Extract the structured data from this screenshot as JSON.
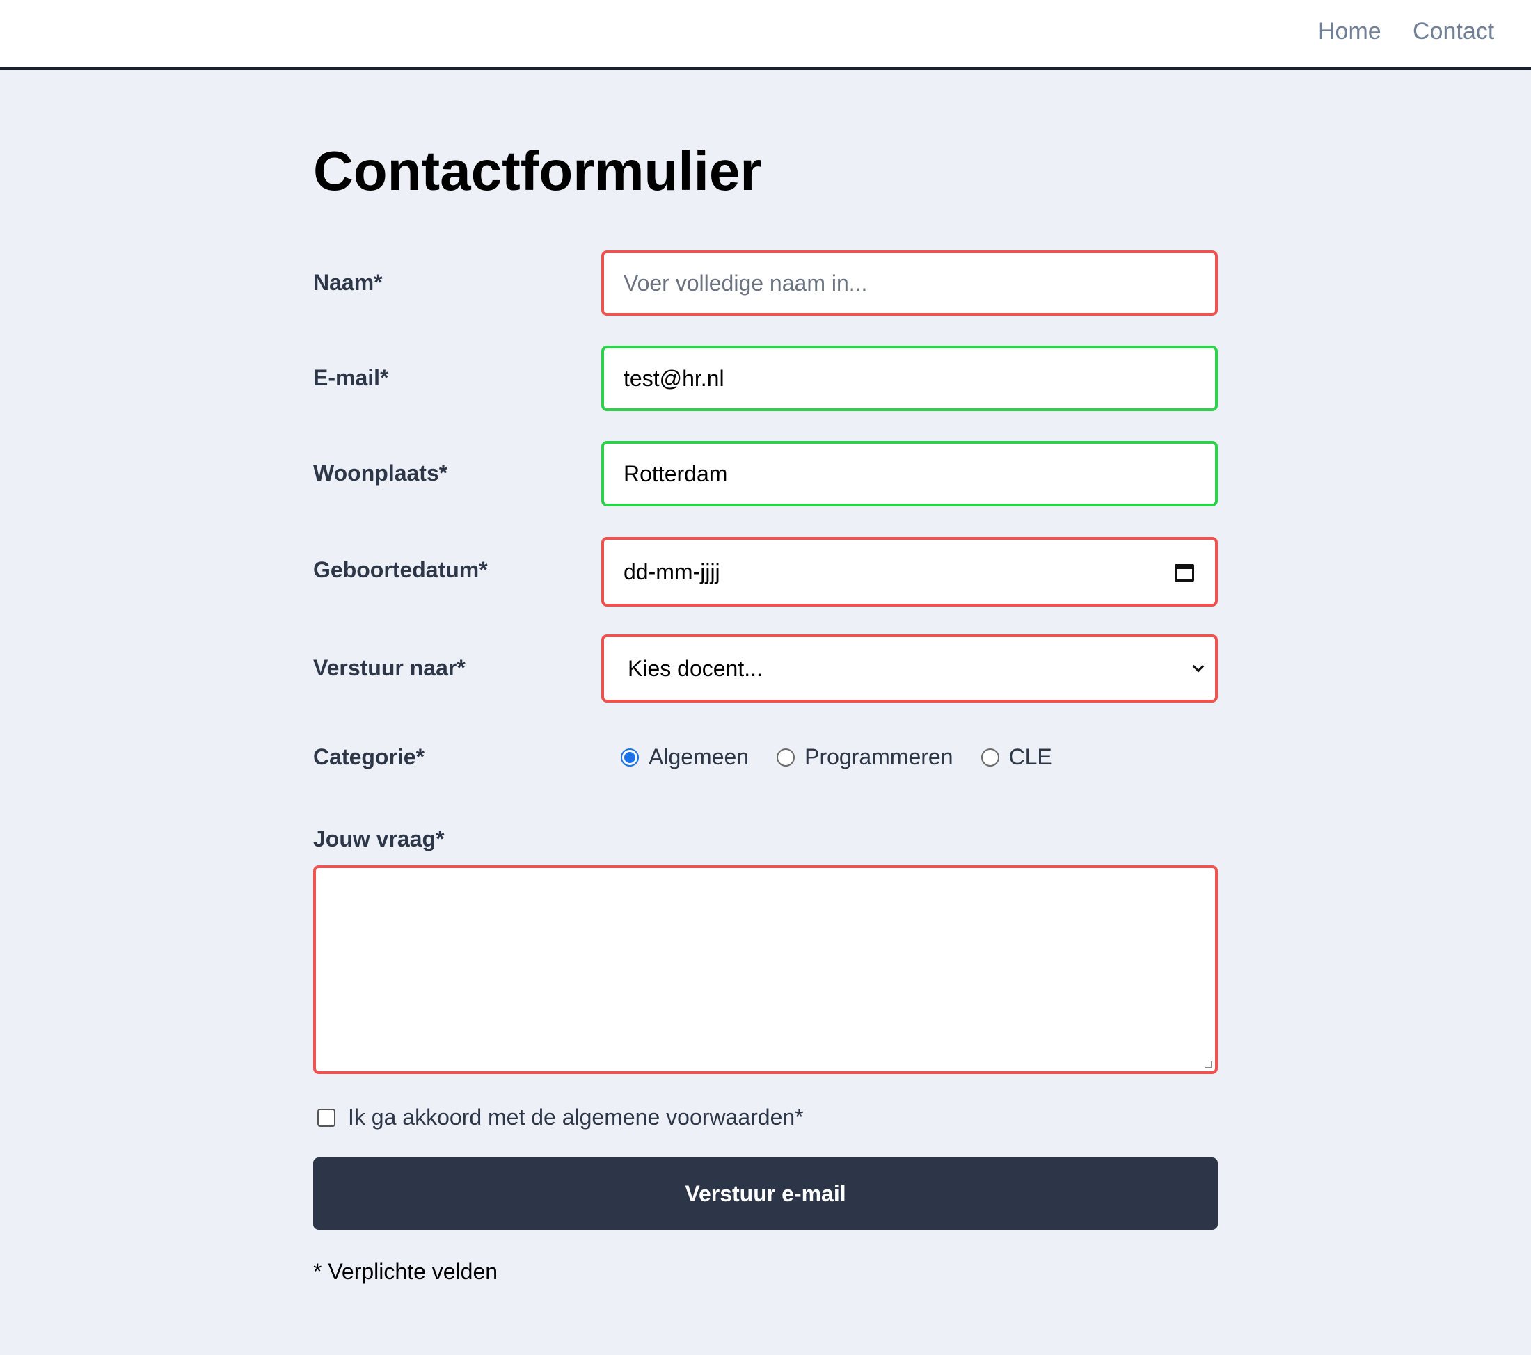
{
  "nav": {
    "home": "Home",
    "contact": "Contact"
  },
  "page_title": "Contactformulier",
  "fields": {
    "naam": {
      "label": "Naam*",
      "value": "",
      "placeholder": "Voer volledige naam in...",
      "state": "invalid"
    },
    "email": {
      "label": "E-mail*",
      "value": "test@hr.nl",
      "placeholder": "",
      "state": "valid"
    },
    "woonplaats": {
      "label": "Woonplaats*",
      "value": "Rotterdam",
      "placeholder": "",
      "state": "valid"
    },
    "geboortedatum": {
      "label": "Geboortedatum*",
      "display": "dd-mm-jjjj",
      "state": "invalid"
    },
    "verstuur_naar": {
      "label": "Verstuur naar*",
      "selected": "Kies docent...",
      "state": "invalid"
    },
    "categorie": {
      "label": "Categorie*",
      "options": [
        "Algemeen",
        "Programmeren",
        "CLE"
      ],
      "selected": "Algemeen"
    },
    "vraag": {
      "label": "Jouw vraag*",
      "value": "",
      "state": "invalid"
    }
  },
  "terms": {
    "label": "Ik ga akkoord met de algemene voorwaarden*",
    "checked": false
  },
  "submit_label": "Verstuur e-mail",
  "footnote": "* Verplichte velden",
  "colors": {
    "invalid": "#ef5350",
    "valid": "#2ed14a",
    "button": "#2d3648",
    "background": "#edf0f7",
    "radio_accent": "#1a73e8"
  }
}
